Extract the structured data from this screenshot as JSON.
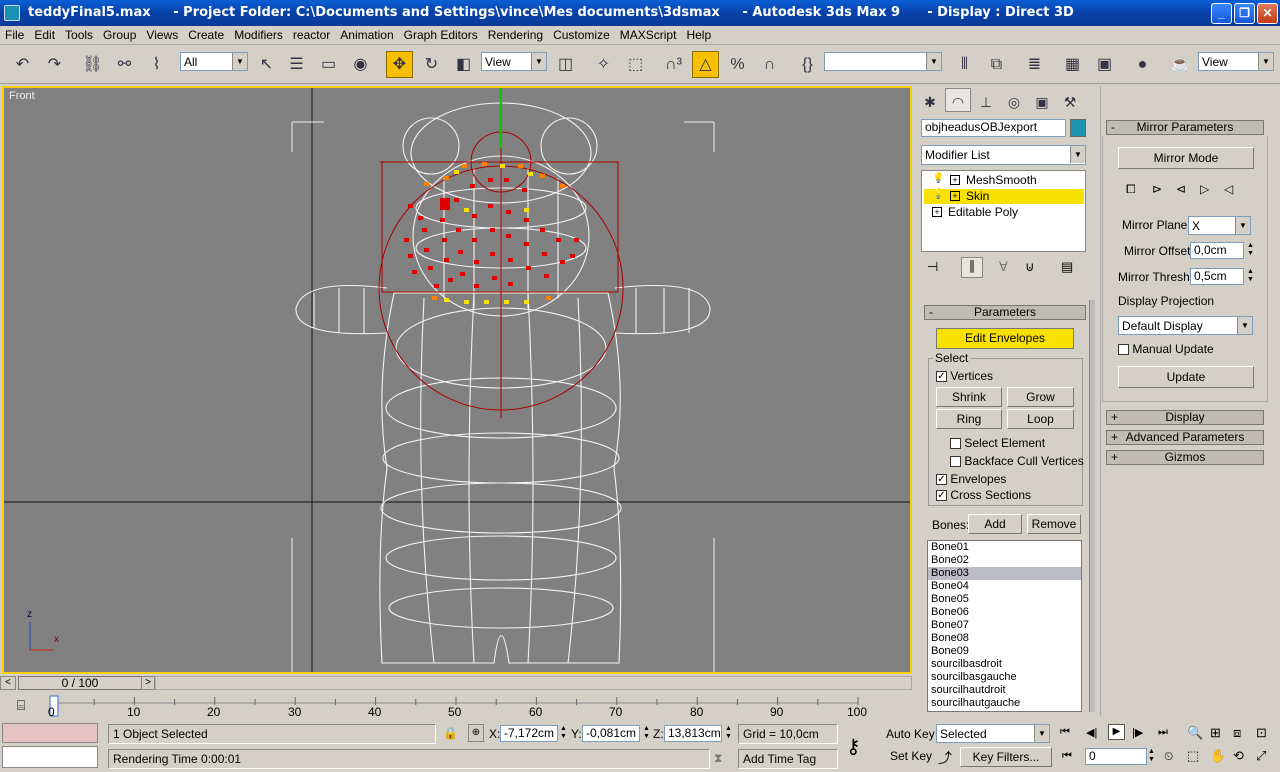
{
  "window": {
    "title": "teddyFinal5.max     - Project Folder: C:\\Documents and Settings\\vince\\Mes documents\\3dsmax     - Autodesk 3ds Max 9      - Display : Direct 3D",
    "minimize": "_",
    "maximize": "❐",
    "close": "✕"
  },
  "menu": [
    "File",
    "Edit",
    "Tools",
    "Group",
    "Views",
    "Create",
    "Modifiers",
    "reactor",
    "Animation",
    "Graph Editors",
    "Rendering",
    "Customize",
    "MAXScript",
    "Help"
  ],
  "toolbar": {
    "selection_filter": "All",
    "ref_coord": "View",
    "named_sel": "",
    "viewport_layout": "View"
  },
  "viewport": {
    "label": "Front",
    "axis_z": "z",
    "axis_x": "x"
  },
  "timeline": {
    "frame": "0 / 100",
    "ticks": [
      "0",
      "10",
      "20",
      "30",
      "40",
      "50",
      "60",
      "70",
      "80",
      "90",
      "100"
    ]
  },
  "command_panel": {
    "object_name": "objheadusOBJexport",
    "object_color": "#1b94b4",
    "modifier_list": "Modifier List",
    "stack": [
      {
        "label": "MeshSmooth",
        "selected": false
      },
      {
        "label": "Skin",
        "selected": true
      },
      {
        "label": "Editable Poly",
        "selected": false
      }
    ],
    "parameters_title": "Parameters",
    "edit_envelopes": "Edit Envelopes",
    "select_group": "Select",
    "vertices": "Vertices",
    "shrink": "Shrink",
    "grow": "Grow",
    "ring": "Ring",
    "loop": "Loop",
    "select_element": "Select Element",
    "backface_cull": "Backface Cull Vertices",
    "envelopes": "Envelopes",
    "cross_sections": "Cross Sections",
    "bones_label": "Bones:",
    "add": "Add",
    "remove": "Remove",
    "bones": [
      "Bone01",
      "Bone02",
      "Bone03",
      "Bone04",
      "Bone05",
      "Bone06",
      "Bone07",
      "Bone08",
      "Bone09",
      "sourcilbasdroit",
      "sourcilbasgauche",
      "sourcilhautdroit",
      "sourcilhautgauche"
    ],
    "selected_bone": "Bone03"
  },
  "mirror_panel": {
    "title": "Mirror Parameters",
    "mirror_mode": "Mirror Mode",
    "mirror_plane_label": "Mirror Plane:",
    "mirror_plane": "X",
    "mirror_offset_label": "Mirror Offset:",
    "mirror_offset": "0,0cm",
    "mirror_thresh_label": "Mirror Thresh.:",
    "mirror_thresh": "0,5cm",
    "display_projection_label": "Display Projection",
    "display_projection": "Default Display",
    "manual_update": "Manual Update",
    "update": "Update",
    "rollups": [
      "Display",
      "Advanced Parameters",
      "Gizmos"
    ]
  },
  "status": {
    "selection": "1 Object Selected",
    "render_time": "Rendering Time  0:00:01",
    "x_label": "X:",
    "x": "-7,172cm",
    "y_label": "Y:",
    "y": "-0,081cm",
    "z_label": "Z:",
    "z": "13,813cm",
    "grid": "Grid = 10,0cm",
    "add_time_tag": "Add Time Tag",
    "auto_key": "Auto Key",
    "set_key": "Set Key",
    "key_mode": "Selected",
    "key_filters": "Key Filters...",
    "current_frame": "0"
  }
}
